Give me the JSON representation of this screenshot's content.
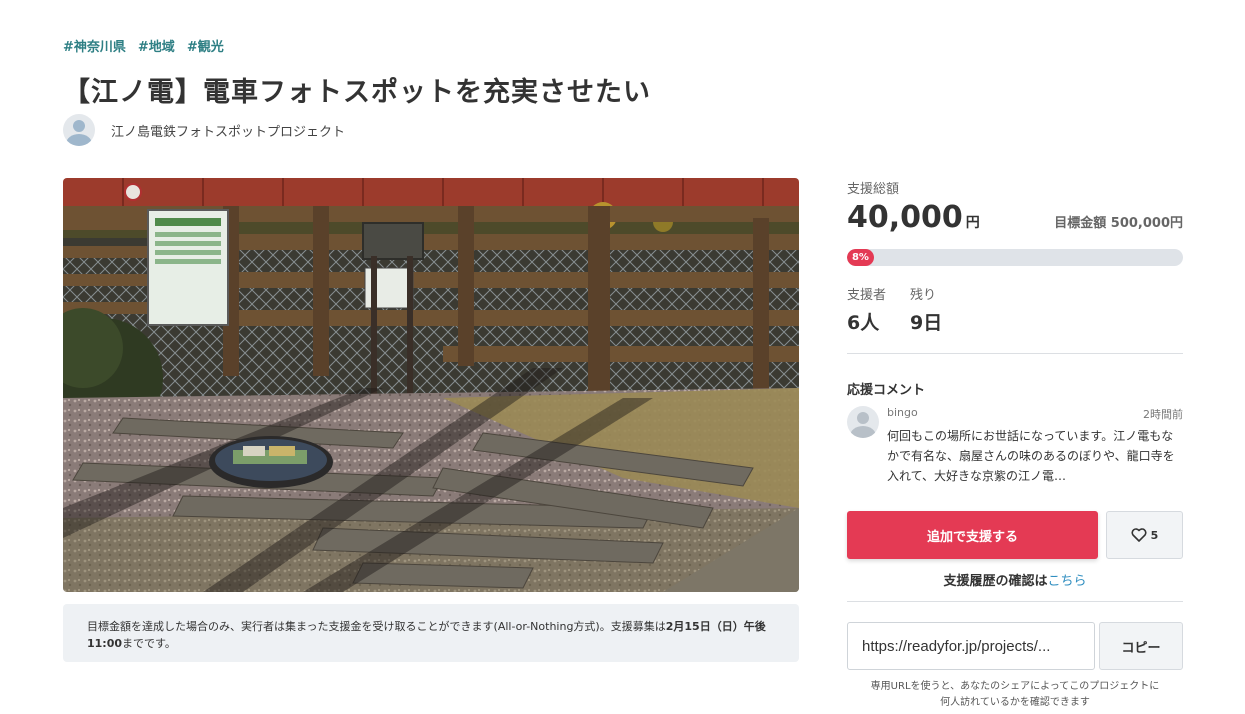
{
  "tags": [
    "#神奈川県",
    "#地域",
    "#観光"
  ],
  "project": {
    "title": "【江ノ電】電車フォトスポットを充実させたい",
    "owner_name": "江ノ島電鉄フォトスポットプロジェクト"
  },
  "notice": {
    "text_before": "目標金額を達成した場合のみ、実行者は集まった支援金を受け取ることができます(All-or-Nothing方式)。支援募集は",
    "deadline": "2月15日（日）午後11:00",
    "text_after": "までです。"
  },
  "funding": {
    "raised_label": "支援総額",
    "raised_amount": "40,000",
    "currency": "円",
    "goal_label": "目標金額",
    "goal_amount": "500,000円",
    "progress_text": "8%",
    "progress_fraction": 0.08
  },
  "stats": {
    "supporters_label": "支援者",
    "supporters_value": "6人",
    "remaining_label": "残り",
    "remaining_value": "9日"
  },
  "comments": {
    "title": "応援コメント",
    "items": [
      {
        "user": "bingo",
        "time": "2時間前",
        "text": "何回もこの場所にお世話になっています。江ノ電もなかで有名な、扇屋さんの味のあるのぼりや、龍口寺を入れて、大好きな京紫の江ノ電…"
      }
    ]
  },
  "actions": {
    "support_label": "追加で支援する",
    "like_count": "5"
  },
  "history": {
    "text": "支援履歴の確認は",
    "link": "こちら"
  },
  "share": {
    "url_value": "https://readyfor.jp/projects/...",
    "copy_label": "コピー",
    "note": "専用URLを使うと、あなたのシェアによってこのプロジェクトに何人訪れているかを確認できます"
  },
  "colors": {
    "accent": "#e43a54",
    "tag": "#2e7f84",
    "link": "#2f8ec0"
  }
}
